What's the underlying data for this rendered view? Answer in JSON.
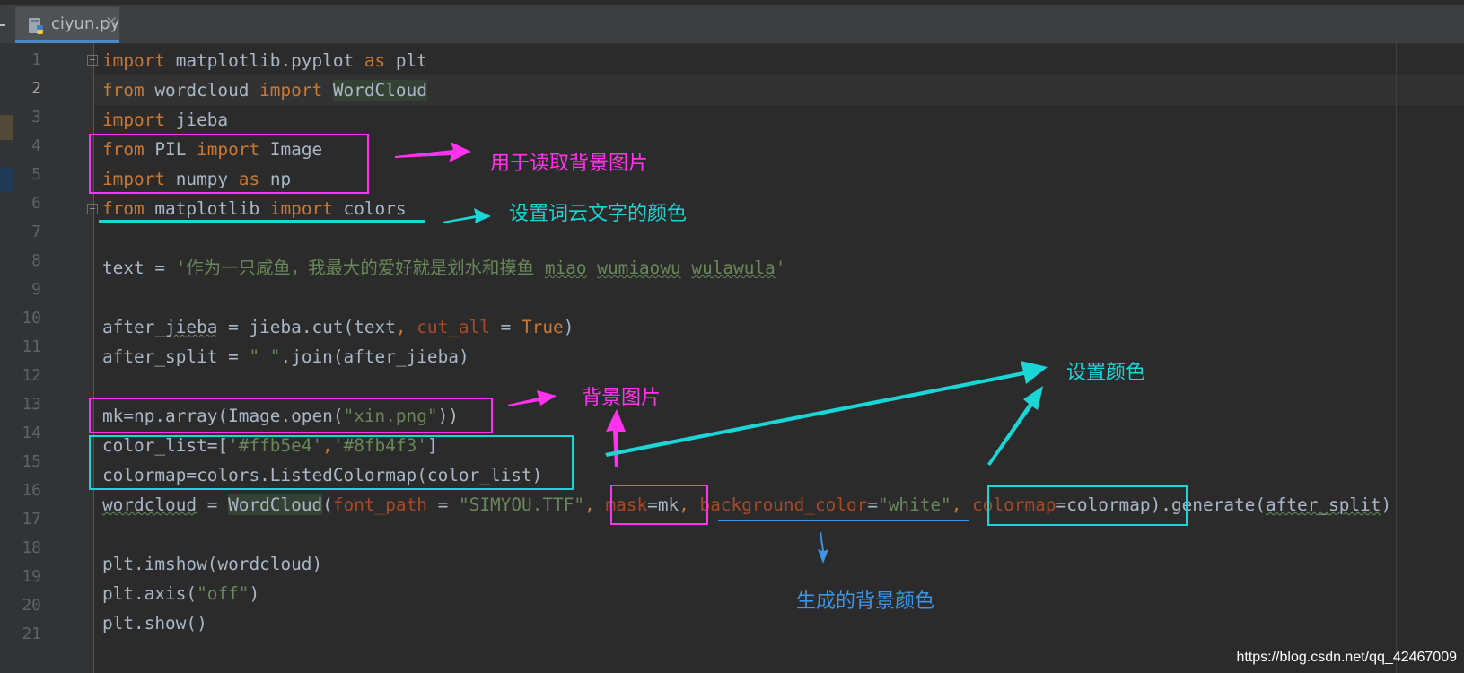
{
  "tab": {
    "title": "ciyun.py",
    "close": "✕",
    "icon": "python-file-icon"
  },
  "gutter": {
    "line_numbers": [
      "1",
      "2",
      "3",
      "4",
      "5",
      "6",
      "7",
      "8",
      "9",
      "10",
      "11",
      "12",
      "13",
      "14",
      "15",
      "16",
      "17",
      "18",
      "19",
      "20",
      "21"
    ],
    "current_line": "2"
  },
  "code": {
    "l1": {
      "kw1": "import",
      "mod": " matplotlib.pyplot ",
      "kw2": "as",
      "alias": " plt"
    },
    "l2": {
      "kw1": "from",
      "mod": " wordcloud ",
      "kw2": "import",
      "sp": " ",
      "cls": "WordCloud"
    },
    "l3": {
      "kw1": "import",
      "mod": " jieba"
    },
    "l4": {
      "kw1": "from",
      "mod": " PIL ",
      "kw2": "import",
      "cls": " Image"
    },
    "l5": {
      "kw1": "import",
      "mod": " numpy ",
      "kw2": "as",
      "alias": " np"
    },
    "l6": {
      "kw1": "from",
      "mod": " matplotlib ",
      "kw2": "import",
      "cls": " colors"
    },
    "l8": {
      "lhs": "text = ",
      "str_prefix": "'作为一只咸鱼，我最大的爱好就是划水和摸鱼 ",
      "w1": "miao",
      "sp1": " ",
      "w2": "wumiaowu",
      "sp2": " ",
      "w3": "wulawula",
      "str_suffix": "'"
    },
    "l10": {
      "p1": "after_",
      "w_jieba": "jieba",
      "p2": " = jieba.cut(text",
      "comma": ", ",
      "prm": "cut_all",
      "eq": " = ",
      "val": "True",
      "close": ")"
    },
    "l11": {
      "p1": "after_split = ",
      "str": "\" \"",
      "p2": ".join(after_jieba)"
    },
    "l13": {
      "p1": "mk=np.array(Image.open(",
      "str": "\"xin.png\"",
      "p2": "))"
    },
    "l14": {
      "p1": "color_list=[",
      "s1": "'#ffb5e4'",
      "comma": ",",
      "s2": "'#8fb4f3'",
      "p2": "]"
    },
    "l15": {
      "p1": "colormap=colors.ListedColormap(color_list)"
    },
    "l16": {
      "var": "wordcloud",
      "eq": " = ",
      "cls": "WordCloud",
      "op": "(",
      "prm1": "font_path",
      "eq1": " = ",
      "str1": "\"SIMYOU.TTF\"",
      "c1": ", ",
      "prm2": "mask",
      "eq2": "=mk",
      "c2": ", ",
      "prm3": "background_color",
      "eq3": "=",
      "str3": "\"white\"",
      "c3": ", ",
      "prm4": "colormap",
      "eq4": "=colormap",
      "p_gen": ").generate(",
      "arg": "after_split",
      "close": ")"
    },
    "l18": {
      "p1": "plt.imshow(wordcloud)"
    },
    "l19": {
      "p1": "plt.axis(",
      "str": "\"off\"",
      "p2": ")"
    },
    "l20": {
      "p1": "plt.show()"
    }
  },
  "annotations": {
    "read_background": "用于读取背景图片",
    "set_wordcloud_color": "设置词云文字的颜色",
    "background_image": "背景图片",
    "set_color": "设置颜色",
    "generated_bg_color": "生成的背景颜色"
  },
  "colors": {
    "magenta": "#ff33ee",
    "cyan": "#1ad6d6",
    "blue": "#3c95e6"
  },
  "watermark": "https://blog.csdn.net/qq_42467009"
}
